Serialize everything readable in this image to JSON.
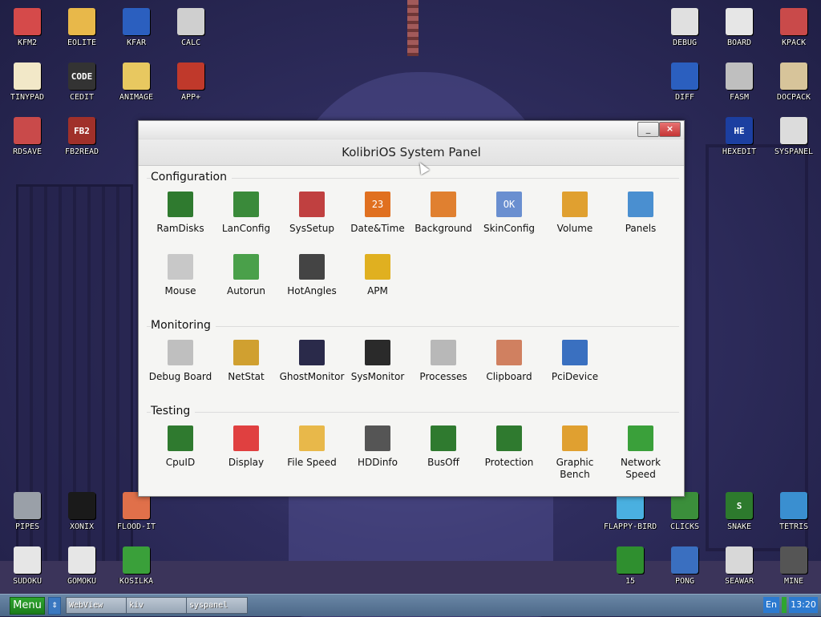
{
  "desktop": {
    "icons": [
      {
        "label": "KFM2",
        "icon": "floppy-icon",
        "color": "#d54a4a"
      },
      {
        "label": "EOLITE",
        "icon": "folder-icon",
        "color": "#e8b84a"
      },
      {
        "label": "KFAR",
        "icon": "panels-icon",
        "color": "#2b5fbf"
      },
      {
        "label": "CALC",
        "icon": "calculator-icon",
        "color": "#cfcfcf"
      },
      {
        "label": "DEBUG",
        "icon": "bug-icon",
        "color": "#e0e0e0"
      },
      {
        "label": "BOARD",
        "icon": "board-icon",
        "color": "#e6e6e6"
      },
      {
        "label": "KPACK",
        "icon": "hammer-icon",
        "color": "#c94a4a"
      },
      {
        "label": "TINYPAD",
        "icon": "notepad-icon",
        "color": "#f2e8c8"
      },
      {
        "label": "CEDIT",
        "icon": "code-icon",
        "color": "#333333",
        "glyph": "CODE"
      },
      {
        "label": "ANIMAGE",
        "icon": "brush-icon",
        "color": "#e8c860"
      },
      {
        "label": "APP+",
        "icon": "cube-icon",
        "color": "#c0392b"
      },
      {
        "label": "DIFF",
        "icon": "diff-icon",
        "color": "#2b5fbf"
      },
      {
        "label": "FASM",
        "icon": "fasm-icon",
        "color": "#bfbfbf"
      },
      {
        "label": "DOCPACK",
        "icon": "cabinet-icon",
        "color": "#d7c49a"
      },
      {
        "label": "RDSAVE",
        "icon": "save-icon",
        "color": "#c94a4a"
      },
      {
        "label": "FB2READ",
        "icon": "book-icon",
        "color": "#a0302a",
        "glyph": "FB2"
      },
      {
        "label": "HEXEDIT",
        "icon": "hex-icon",
        "color": "#1c3fa0",
        "glyph": "HE"
      },
      {
        "label": "SYSPANEL",
        "icon": "sliders-icon",
        "color": "#dcdcdc"
      },
      {
        "label": "PIPES",
        "icon": "pipes-icon",
        "color": "#9aa0a8"
      },
      {
        "label": "XONIX",
        "icon": "xonix-icon",
        "color": "#1a1a1a"
      },
      {
        "label": "FLOOD-IT",
        "icon": "grid-icon",
        "color": "#e0704a"
      },
      {
        "label": "FLAPPY-BIRD",
        "icon": "bird-icon",
        "color": "#4ab0e0"
      },
      {
        "label": "CLICKS",
        "icon": "blocks-icon",
        "color": "#3b8f3b"
      },
      {
        "label": "SNAKE",
        "icon": "snake-icon",
        "color": "#2d7a2d",
        "glyph": "S"
      },
      {
        "label": "TETRIS",
        "icon": "tetris-icon",
        "color": "#3a8fd0"
      },
      {
        "label": "SUDOKU",
        "icon": "sudoku-icon",
        "color": "#e6e6e6"
      },
      {
        "label": "GOMOKU",
        "icon": "gomoku-icon",
        "color": "#e6e6e6"
      },
      {
        "label": "KOSILKA",
        "icon": "mower-icon",
        "color": "#3aa03a"
      },
      {
        "label": "15",
        "icon": "puzzle15-icon",
        "color": "#2f8f2f"
      },
      {
        "label": "PONG",
        "icon": "pong-icon",
        "color": "#3a6fc0"
      },
      {
        "label": "SEAWAR",
        "icon": "ship-icon",
        "color": "#d8d8d8"
      },
      {
        "label": "MINE",
        "icon": "mine-icon",
        "color": "#555555"
      }
    ]
  },
  "window": {
    "title": "KolibriOS System Panel",
    "min_label": "_",
    "close_label": "×",
    "sections": [
      {
        "title": "Configuration",
        "items": [
          {
            "label": "RamDisks",
            "icon": "ram-icon",
            "color": "#2f7a2f"
          },
          {
            "label": "LanConfig",
            "icon": "network-card-icon",
            "color": "#3a8a3a"
          },
          {
            "label": "SysSetup",
            "icon": "tools-icon",
            "color": "#c04040"
          },
          {
            "label": "Date&Time",
            "icon": "calendar-icon",
            "color": "#e07020",
            "glyph": "23"
          },
          {
            "label": "Background",
            "icon": "monitor-icon",
            "color": "#e08030"
          },
          {
            "label": "SkinConfig",
            "icon": "skin-icon",
            "color": "#6a8fd0",
            "glyph": "OK"
          },
          {
            "label": "Volume",
            "icon": "speaker-icon",
            "color": "#e0a030"
          },
          {
            "label": "Panels",
            "icon": "panels-icon",
            "color": "#4a8fd0"
          },
          {
            "label": "Mouse",
            "icon": "mouse-icon",
            "color": "#c8c8c8"
          },
          {
            "label": "Autorun",
            "icon": "autorun-icon",
            "color": "#4aa04a"
          },
          {
            "label": "HotAngles",
            "icon": "screen-corners-icon",
            "color": "#444444"
          },
          {
            "label": "APM",
            "icon": "battery-icon",
            "color": "#e0b020"
          }
        ]
      },
      {
        "title": "Monitoring",
        "items": [
          {
            "label": "Debug Board",
            "icon": "debug-board-icon",
            "color": "#bfbfbf"
          },
          {
            "label": "NetStat",
            "icon": "netstat-icon",
            "color": "#d0a030"
          },
          {
            "label": "GhostMonitor",
            "icon": "oscilloscope-icon",
            "color": "#2a2a4a"
          },
          {
            "label": "SysMonitor",
            "icon": "sysmonitor-icon",
            "color": "#2a2a2a"
          },
          {
            "label": "Processes",
            "icon": "windows-icon",
            "color": "#b8b8b8"
          },
          {
            "label": "Clipboard",
            "icon": "clipboard-icon",
            "color": "#d08060"
          },
          {
            "label": "PciDevice",
            "icon": "pci-card-icon",
            "color": "#3a70c0"
          }
        ]
      },
      {
        "title": "Testing",
        "items": [
          {
            "label": "CpuID",
            "icon": "cpu-icon",
            "color": "#2f7a2f"
          },
          {
            "label": "Display",
            "icon": "display-test-icon",
            "color": "#e04040"
          },
          {
            "label": "File Speed",
            "icon": "folder-icon",
            "color": "#e8b84a"
          },
          {
            "label": "HDDinfo",
            "icon": "hdd-icon",
            "color": "#555555"
          },
          {
            "label": "BusOff",
            "icon": "chip-icon",
            "color": "#2f7a2f"
          },
          {
            "label": "Protection",
            "icon": "chip-shield-icon",
            "color": "#2f7a2f"
          },
          {
            "label": "Graphic Bench",
            "icon": "gauge-icon",
            "color": "#e0a030"
          },
          {
            "label": "Network Speed",
            "icon": "download-icon",
            "color": "#3aa03a"
          }
        ]
      }
    ]
  },
  "taskbar": {
    "menu_label": "Menu",
    "arrows_label": "⇕",
    "tasks": [
      "WebView",
      "kiv",
      "syspanel"
    ],
    "lang": "En",
    "clock": "13:20"
  }
}
